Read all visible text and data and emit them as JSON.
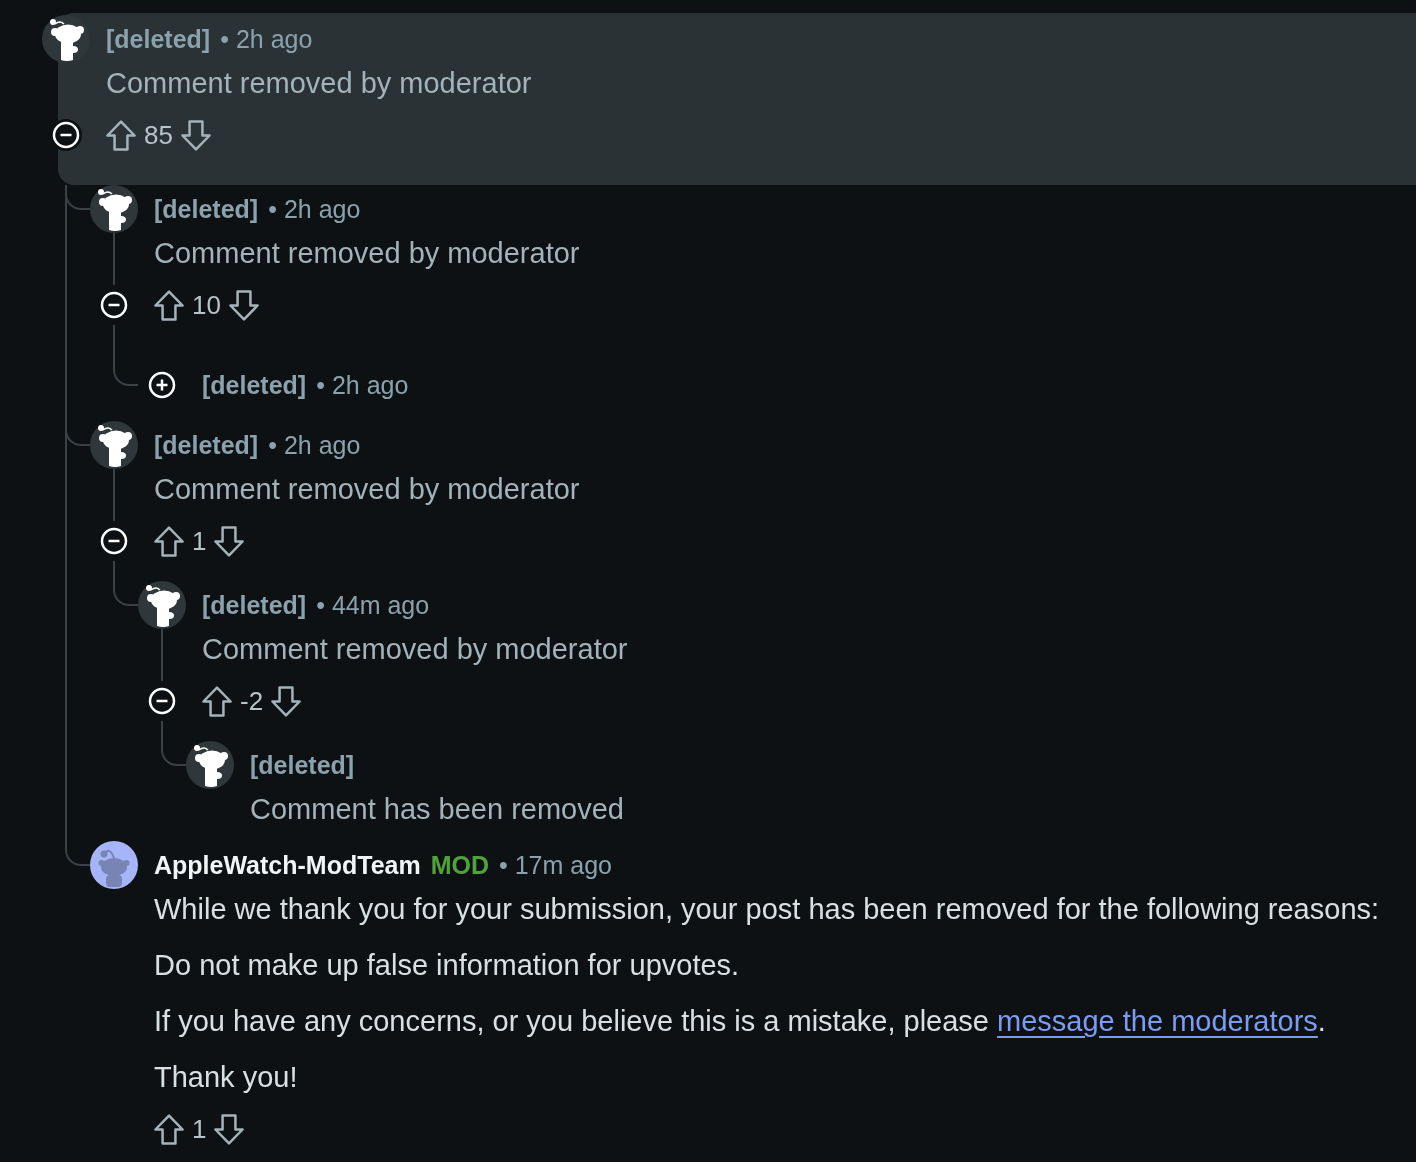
{
  "comments": [
    {
      "kind": "deleted",
      "author": "[deleted]",
      "time": "• 2h ago",
      "highlighted": true,
      "expanded": true,
      "body": [
        {
          "text": "Comment removed by moderator"
        }
      ],
      "score": "85",
      "replies": [
        {
          "kind": "deleted",
          "author": "[deleted]",
          "time": "• 2h ago",
          "highlighted": false,
          "expanded": true,
          "body": [
            {
              "text": "Comment removed by moderator"
            }
          ],
          "score": "10",
          "replies": [
            {
              "kind": "deleted",
              "author": "[deleted]",
              "time": "• 2h ago",
              "highlighted": false,
              "expanded": false
            }
          ]
        },
        {
          "kind": "deleted",
          "author": "[deleted]",
          "time": "• 2h ago",
          "highlighted": false,
          "expanded": true,
          "body": [
            {
              "text": "Comment removed by moderator"
            }
          ],
          "score": "1",
          "replies": [
            {
              "kind": "deleted",
              "author": "[deleted]",
              "time": "• 44m ago",
              "highlighted": false,
              "expanded": true,
              "body": [
                {
                  "text": "Comment removed by moderator"
                }
              ],
              "score": "-2",
              "replies": [
                {
                  "kind": "deleted",
                  "author": "[deleted]",
                  "highlighted": false,
                  "body": [
                    {
                      "text": "Comment has been removed"
                    }
                  ]
                }
              ]
            }
          ]
        },
        {
          "kind": "moderator",
          "author": "AppleWatch-ModTeam",
          "flair": "MOD",
          "time": "• 17m ago",
          "highlighted": false,
          "body": [
            {
              "text": "While we thank you for your submission, your post has been removed for the following reasons:"
            },
            {
              "text": "Do not make up false information for upvotes."
            },
            {
              "text": "If you have any concerns, or you believe this is a mistake, please",
              "link": "message the moderators",
              "after": "."
            },
            {
              "text": "Thank you!"
            }
          ],
          "score": "1"
        }
      ]
    }
  ]
}
